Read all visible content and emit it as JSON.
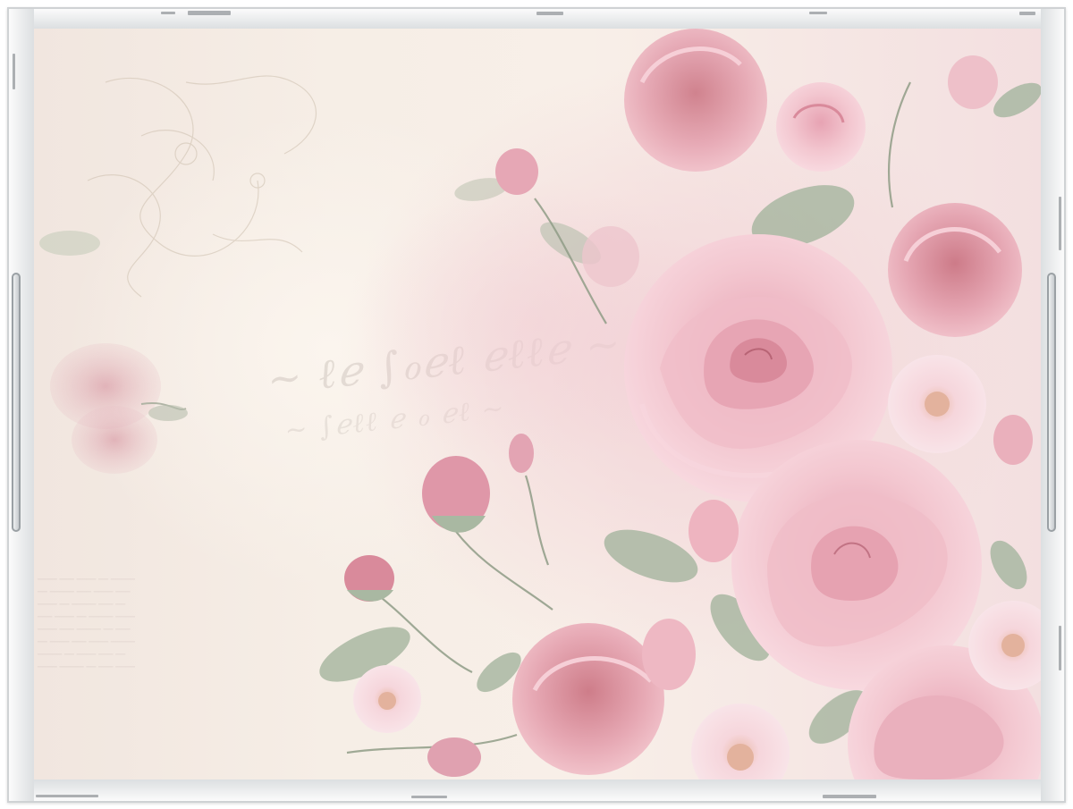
{
  "artwork": {
    "palette": {
      "background": "#f6eee6",
      "rose_light": "#f2c6cf",
      "rose_mid": "#e9a6b4",
      "rose_dark": "#c9707f",
      "leaf": "#a9b8a2",
      "frame": "#e9ebec"
    }
  }
}
